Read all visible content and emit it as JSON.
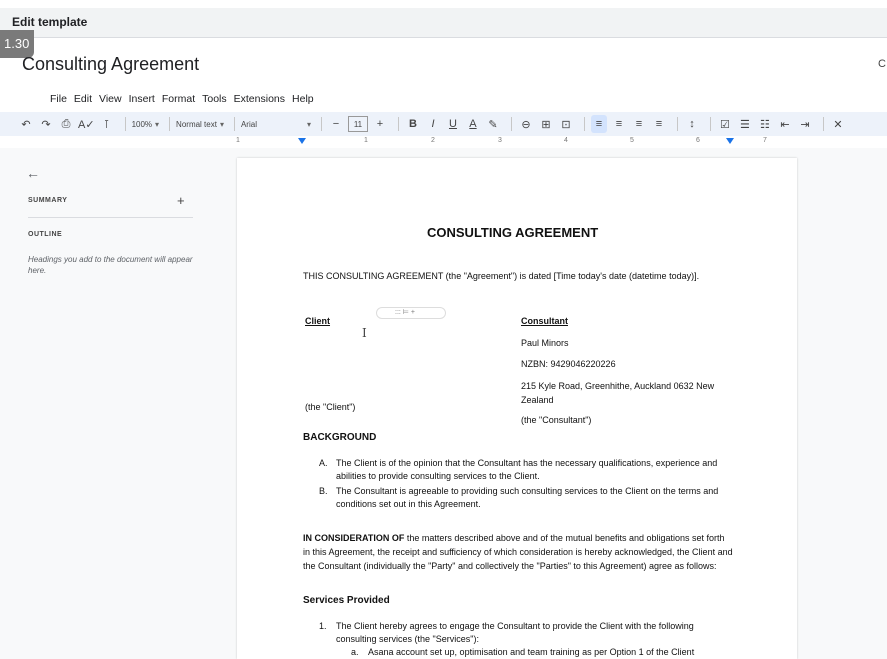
{
  "window": {
    "title": "Edit template",
    "badge": "1.30",
    "edge_char": "C"
  },
  "document": {
    "title": "Consulting Agreement"
  },
  "menu": [
    "File",
    "Edit",
    "View",
    "Insert",
    "Format",
    "Tools",
    "Extensions",
    "Help"
  ],
  "toolbar": {
    "undo": "↶",
    "redo": "↷",
    "print": "⎙",
    "spell": "A✓",
    "paint": "⊺",
    "zoom": "100%",
    "style": "Normal text",
    "font": "Arial",
    "font_size": "11",
    "minus": "−",
    "plus": "+",
    "bold": "B",
    "italic": "I",
    "underline": "U",
    "text_color": "A",
    "highlight": "✎",
    "link": "⊖",
    "comment": "⊞",
    "image": "⊡",
    "align_left": "≡",
    "align_center": "≡",
    "align_right": "≡",
    "align_justify": "≡",
    "line_spacing": "↕",
    "checklist": "☑",
    "bullets": "☰",
    "numbered": "☷",
    "indent_less": "⇤",
    "indent_more": "⇥",
    "clear": "✕",
    "dropdown": "▾"
  },
  "ruler": {
    "numbers": [
      "1",
      "1",
      "2",
      "3",
      "4",
      "5",
      "6",
      "7"
    ]
  },
  "sidebar": {
    "back": "←",
    "summary_label": "SUMMARY",
    "summary_add": "+",
    "outline_label": "OUTLINE",
    "outline_hint": "Headings you add to the document will appear here."
  },
  "page": {
    "heading": "CONSULTING AGREEMENT",
    "intro": "THIS CONSULTING AGREEMENT (the \"Agreement\") is dated [Time today's date (datetime today)].",
    "client_label": "Client",
    "client_suffix": "(the \"Client\")",
    "chip_text": "::: ⊨ +",
    "cursor": "I",
    "consultant_label": "Consultant",
    "consultant_name": "Paul Minors",
    "consultant_nzbn": "NZBN: 9429046220226",
    "consultant_address": "215 Kyle Road, Greenhithe, Auckland 0632 New Zealand",
    "consultant_suffix": "(the \"Consultant\")",
    "background_heading": "BACKGROUND",
    "background_items": [
      {
        "marker": "A.",
        "text": "The Client is of the opinion that the Consultant has the necessary qualifications, experience and abilities to provide consulting services to the Client."
      },
      {
        "marker": "B.",
        "text": "The Consultant is agreeable to providing such consulting services to the Client on the terms and conditions set out in this Agreement."
      }
    ],
    "consideration_lead": "IN CONSIDERATION OF",
    "consideration_text": " the matters described above and of the mutual benefits and obligations set forth in this Agreement, the receipt and sufficiency of which consideration is hereby acknowledged, the Client and the Consultant (individually the \"Party\" and collectively the \"Parties\" to this Agreement) agree as follows:",
    "services_heading": "Services Provided",
    "services_items": [
      {
        "marker": "1.",
        "text": "The Client hereby agrees to engage the Consultant to provide the Client with the following consulting services (the \"Services\"):"
      }
    ],
    "services_sub_marker": "a.",
    "services_sub_text": "Asana account set up, optimisation and team training as per Option 1 of the Client"
  }
}
